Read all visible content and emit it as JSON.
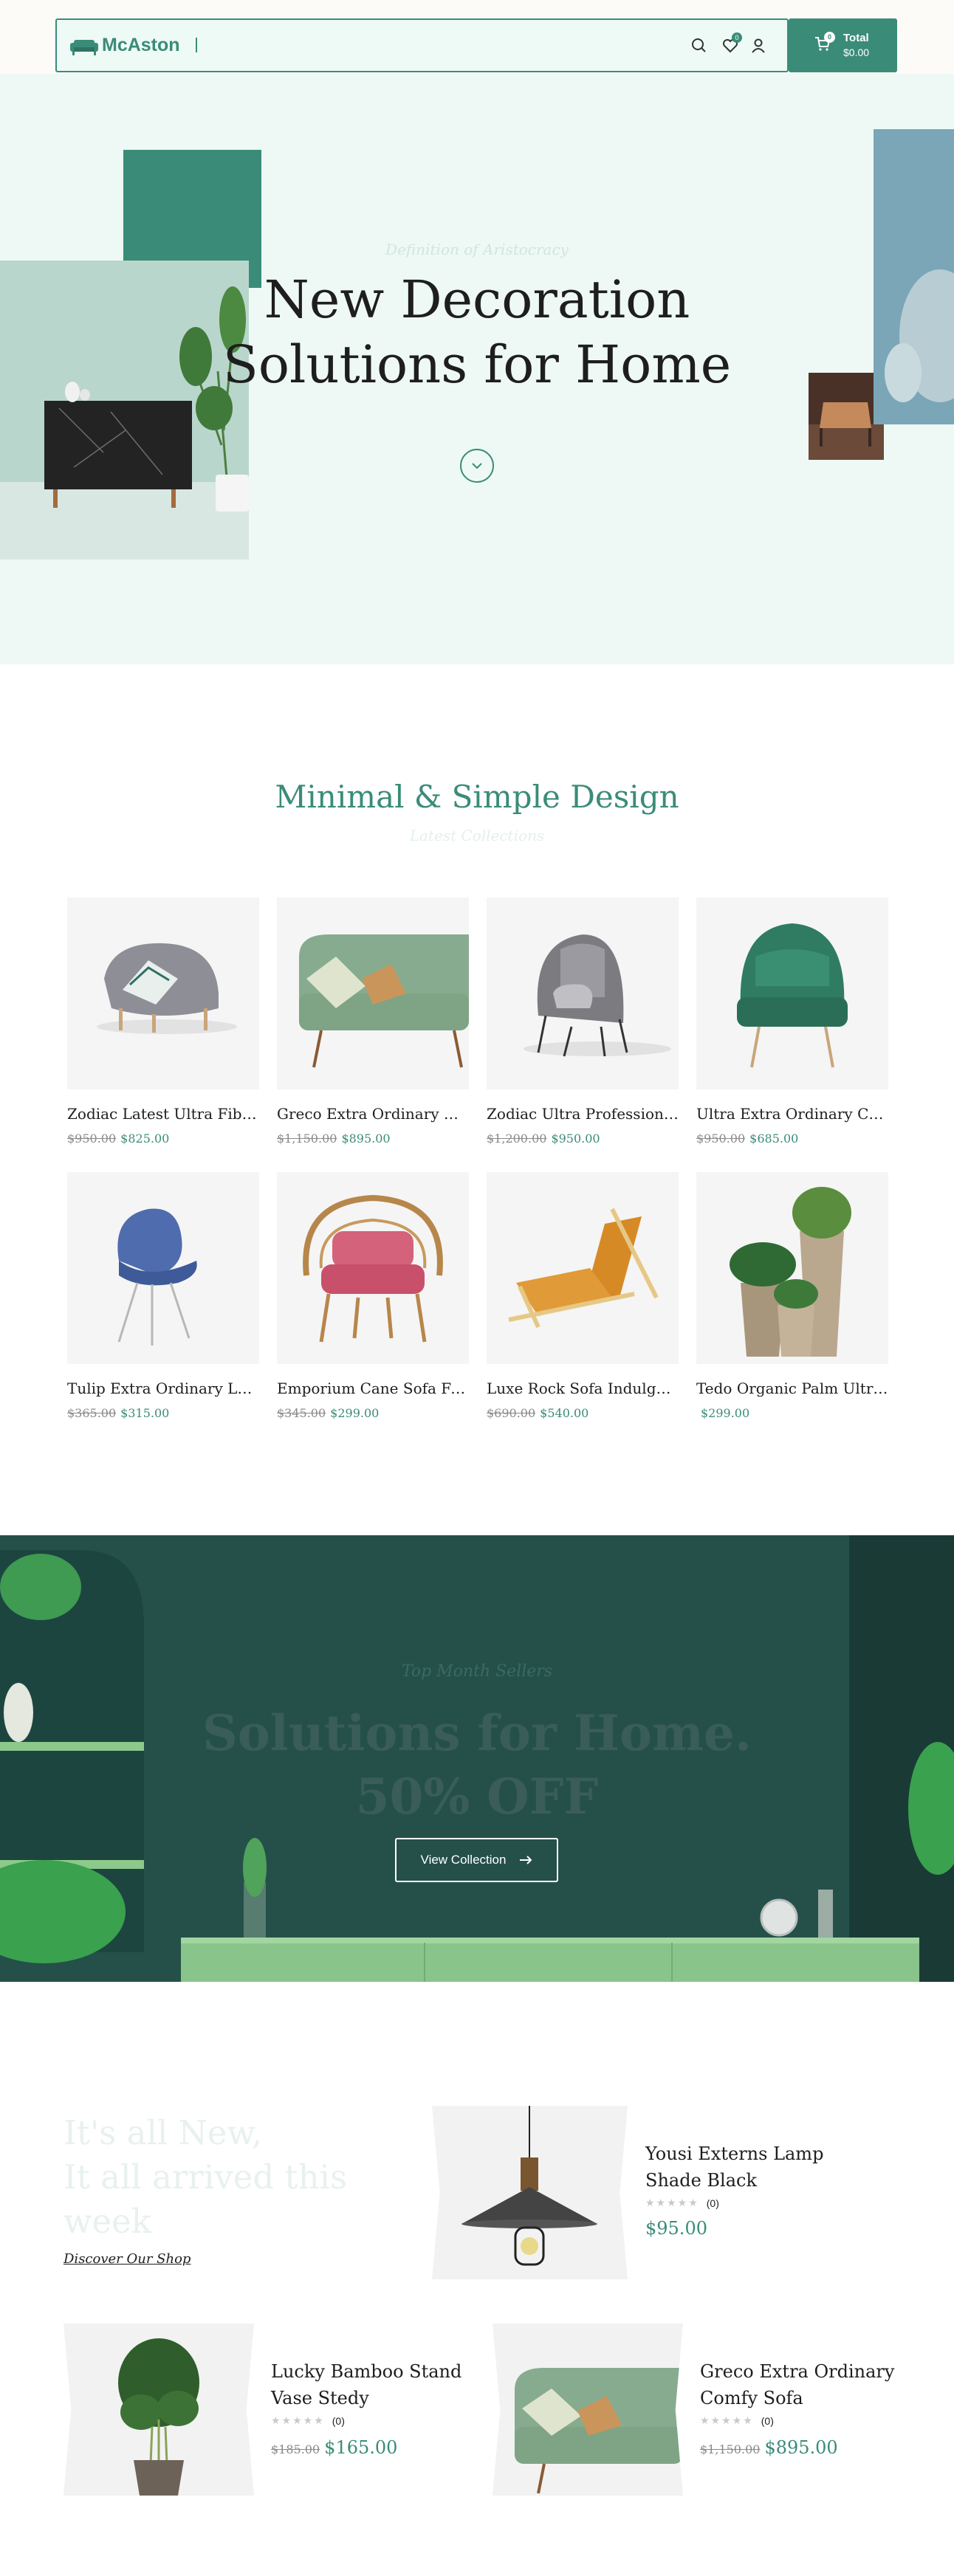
{
  "brand": {
    "name": "McAston",
    "accent": "#3a8c78"
  },
  "header": {
    "icons": [
      "search-icon",
      "heart-icon",
      "user-icon",
      "cart-icon"
    ],
    "wishlist_count": "0",
    "cart_count": "0",
    "cart_label": "Total",
    "cart_total": "$0.00"
  },
  "hero": {
    "eyebrow": "Definition of Aristocracy",
    "title_line1": "New Decoration",
    "title_line2": "Solutions for Home"
  },
  "collections": {
    "title": "Minimal & Simple Design",
    "subtitle": "Latest Collections",
    "products": [
      {
        "name": "Zodiac Latest Ultra Fiber ...",
        "old_price": "$950.00",
        "price": "$825.00"
      },
      {
        "name": "Greco Extra Ordinary Co...",
        "old_price": "$1,150.00",
        "price": "$895.00"
      },
      {
        "name": "Zodiac Ultra Professional ...",
        "old_price": "$1,200.00",
        "price": "$950.00"
      },
      {
        "name": "Ultra Extra Ordinary Co...",
        "old_price": "$950.00",
        "price": "$685.00"
      },
      {
        "name": "Tulip Extra Ordinary Lux...",
        "old_price": "$365.00",
        "price": "$315.00"
      },
      {
        "name": "Emporium Cane Sofa For...",
        "old_price": "$345.00",
        "price": "$299.00"
      },
      {
        "name": "Luxe Rock Sofa Indulge i...",
        "old_price": "$690.00",
        "price": "$540.00"
      },
      {
        "name": "Tedo Organic Palm Ultra ...",
        "old_price": "",
        "price": "$299.00"
      }
    ]
  },
  "promo": {
    "eyebrow": "Top Month Sellers",
    "title_line1": "Solutions for Home.",
    "title_line2": "50% OFF",
    "button": "View Collection"
  },
  "new_arrivals": {
    "heading_line1": "It's all New,",
    "heading_line2": "It all arrived this",
    "heading_line3": "week",
    "link": "Discover Our Shop",
    "items": [
      {
        "name_line1": "Yousi Externs Lamp",
        "name_line2": "Shade Black",
        "reviews": "(0)",
        "old_price": "",
        "price": "$95.00"
      },
      {
        "name_line1": "Lucky Bamboo Stand",
        "name_line2": "Vase Stedy",
        "reviews": "(0)",
        "old_price": "$185.00",
        "price": "$165.00"
      },
      {
        "name_line1": "Greco Extra Ordinary",
        "name_line2": "Comfy Sofa",
        "reviews": "(0)",
        "old_price": "$1,150.00",
        "price": "$895.00"
      }
    ]
  }
}
